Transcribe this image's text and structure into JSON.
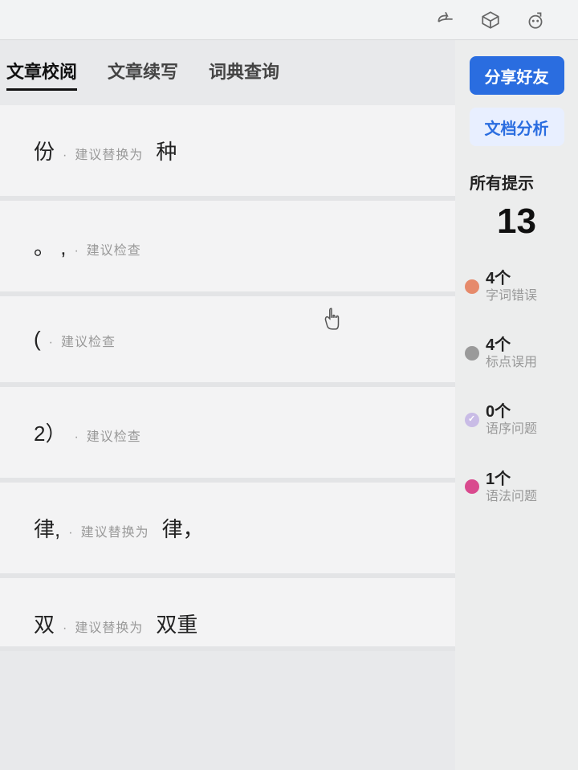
{
  "topbar": {
    "share_icon": "share",
    "cube_icon": "cube",
    "face_icon": "face"
  },
  "tabs": [
    {
      "label": "文章校阅",
      "active": true
    },
    {
      "label": "文章续写",
      "active": false
    },
    {
      "label": "词典查询",
      "active": false
    }
  ],
  "suggestions": [
    {
      "orig": "份",
      "hint": "建议替换为",
      "repl": "种"
    },
    {
      "orig": "。  ,",
      "hint": "建议检查",
      "repl": ""
    },
    {
      "orig": "(",
      "hint": "建议检查",
      "repl": ""
    },
    {
      "orig": "2）",
      "hint": "建议检查",
      "repl": ""
    },
    {
      "orig": "律,",
      "hint": "建议替换为",
      "repl": "律，"
    },
    {
      "orig": "双",
      "hint": "建议替换为",
      "repl": "双重"
    }
  ],
  "sidebar": {
    "share_button": "分享好友",
    "analyze_button": "文档分析",
    "all_hints_title": "所有提示",
    "all_hints_count": "13",
    "categories": [
      {
        "count": "4个",
        "label": "字词错误",
        "color": "#e68a6b"
      },
      {
        "count": "4个",
        "label": "标点误用",
        "color": "#9a9a9a"
      },
      {
        "count": "0个",
        "label": "语序问题",
        "color": "#c9bce6",
        "check": true
      },
      {
        "count": "1个",
        "label": "语法问题",
        "color": "#d94a8e"
      }
    ]
  }
}
